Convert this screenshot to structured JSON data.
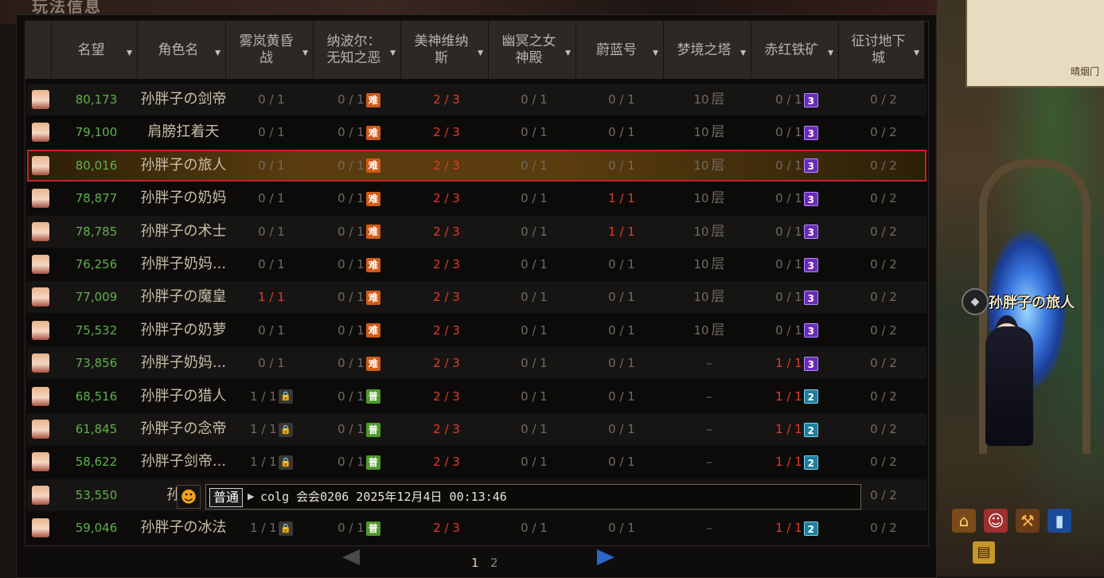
{
  "window": {
    "title": "玩法信息"
  },
  "header": {
    "columns": [
      {
        "label": "名望",
        "sort": true
      },
      {
        "label": "角色名",
        "sort": true
      },
      {
        "label": "雾岚黄昏战",
        "sort": true
      },
      {
        "label": "纳波尔：无知之恶",
        "sort": true
      },
      {
        "label": "美神维纳斯",
        "sort": true
      },
      {
        "label": "幽冥之女神殿",
        "sort": true
      },
      {
        "label": "蔚蓝号",
        "sort": true
      },
      {
        "label": "梦境之塔",
        "sort": true
      },
      {
        "label": "赤红铁矿",
        "sort": true
      },
      {
        "label": "征讨地下城",
        "sort": true
      }
    ]
  },
  "rows": [
    {
      "fame": "80,173",
      "name": "孙胖子の剑帝",
      "c1": "0 / 1",
      "c1red": false,
      "c1badge": "",
      "c2": "0 / 1",
      "c2badge": "难",
      "c3": "2 / 3",
      "c4": "0 / 1",
      "c5": "0 / 1",
      "c5red": false,
      "floor": "10",
      "floor_unit": "层",
      "c7": "0 / 1",
      "c7red": false,
      "c7badge": "3",
      "c8": "0 / 2"
    },
    {
      "fame": "79,100",
      "name": "肩膀扛着天",
      "c1": "0 / 1",
      "c1red": false,
      "c1badge": "",
      "c2": "0 / 1",
      "c2badge": "难",
      "c3": "2 / 3",
      "c4": "0 / 1",
      "c5": "0 / 1",
      "c5red": false,
      "floor": "10",
      "floor_unit": "层",
      "c7": "0 / 1",
      "c7red": false,
      "c7badge": "3",
      "c8": "0 / 2"
    },
    {
      "fame": "80,016",
      "name": "孙胖子の旅人",
      "c1": "0 / 1",
      "c1red": false,
      "c1badge": "",
      "c2": "0 / 1",
      "c2badge": "难",
      "c3": "2 / 3",
      "c4": "0 / 1",
      "c5": "0 / 1",
      "c5red": false,
      "floor": "10",
      "floor_unit": "层",
      "c7": "0 / 1",
      "c7red": false,
      "c7badge": "3",
      "c8": "0 / 2",
      "selected": true
    },
    {
      "fame": "78,877",
      "name": "孙胖子の奶妈",
      "c1": "0 / 1",
      "c1red": false,
      "c1badge": "",
      "c2": "0 / 1",
      "c2badge": "难",
      "c3": "2 / 3",
      "c4": "0 / 1",
      "c5": "1 / 1",
      "c5red": true,
      "floor": "10",
      "floor_unit": "层",
      "c7": "0 / 1",
      "c7red": false,
      "c7badge": "3",
      "c8": "0 / 2"
    },
    {
      "fame": "78,785",
      "name": "孙胖子の术士",
      "c1": "0 / 1",
      "c1red": false,
      "c1badge": "",
      "c2": "0 / 1",
      "c2badge": "难",
      "c3": "2 / 3",
      "c4": "0 / 1",
      "c5": "1 / 1",
      "c5red": true,
      "floor": "10",
      "floor_unit": "层",
      "c7": "0 / 1",
      "c7red": false,
      "c7badge": "3",
      "c8": "0 / 2"
    },
    {
      "fame": "76,256",
      "name": "孙胖子奶妈...",
      "c1": "0 / 1",
      "c1red": false,
      "c1badge": "",
      "c2": "0 / 1",
      "c2badge": "难",
      "c3": "2 / 3",
      "c4": "0 / 1",
      "c5": "0 / 1",
      "c5red": false,
      "floor": "10",
      "floor_unit": "层",
      "c7": "0 / 1",
      "c7red": false,
      "c7badge": "3",
      "c8": "0 / 2"
    },
    {
      "fame": "77,009",
      "name": "孙胖子の魔皇",
      "c1": "1 / 1",
      "c1red": true,
      "c1badge": "",
      "c2": "0 / 1",
      "c2badge": "难",
      "c3": "2 / 3",
      "c4": "0 / 1",
      "c5": "0 / 1",
      "c5red": false,
      "floor": "10",
      "floor_unit": "层",
      "c7": "0 / 1",
      "c7red": false,
      "c7badge": "3",
      "c8": "0 / 2"
    },
    {
      "fame": "75,532",
      "name": "孙胖子の奶萝",
      "c1": "0 / 1",
      "c1red": false,
      "c1badge": "",
      "c2": "0 / 1",
      "c2badge": "难",
      "c3": "2 / 3",
      "c4": "0 / 1",
      "c5": "0 / 1",
      "c5red": false,
      "floor": "10",
      "floor_unit": "层",
      "c7": "0 / 1",
      "c7red": false,
      "c7badge": "3",
      "c8": "0 / 2"
    },
    {
      "fame": "73,856",
      "name": "孙胖子奶妈...",
      "c1": "0 / 1",
      "c1red": false,
      "c1badge": "",
      "c2": "0 / 1",
      "c2badge": "难",
      "c3": "2 / 3",
      "c4": "0 / 1",
      "c5": "0 / 1",
      "c5red": false,
      "floor": "–",
      "floor_unit": "",
      "c7": "1 / 1",
      "c7red": true,
      "c7badge": "3",
      "c8": "0 / 2"
    },
    {
      "fame": "68,516",
      "name": "孙胖子の猎人",
      "c1": "1 / 1",
      "c1red": false,
      "c1badge": "lock",
      "c2": "0 / 1",
      "c2badge": "普",
      "c3": "2 / 3",
      "c4": "0 / 1",
      "c5": "0 / 1",
      "c5red": false,
      "floor": "–",
      "floor_unit": "",
      "c7": "1 / 1",
      "c7red": true,
      "c7badge": "2",
      "c8": "0 / 2"
    },
    {
      "fame": "61,845",
      "name": "孙胖子の念帝",
      "c1": "1 / 1",
      "c1red": false,
      "c1badge": "lock",
      "c2": "0 / 1",
      "c2badge": "普",
      "c3": "2 / 3",
      "c4": "0 / 1",
      "c5": "0 / 1",
      "c5red": false,
      "floor": "–",
      "floor_unit": "",
      "c7": "1 / 1",
      "c7red": true,
      "c7badge": "2",
      "c8": "0 / 2"
    },
    {
      "fame": "58,622",
      "name": "孙胖子剑帝...",
      "c1": "1 / 1",
      "c1red": false,
      "c1badge": "lock",
      "c2": "0 / 1",
      "c2badge": "普",
      "c3": "2 / 3",
      "c4": "0 / 1",
      "c5": "0 / 1",
      "c5red": false,
      "floor": "–",
      "floor_unit": "",
      "c7": "1 / 1",
      "c7red": true,
      "c7badge": "2",
      "c8": "0 / 2"
    },
    {
      "fame": "53,550",
      "name": "孙胖-",
      "c1": "",
      "c1red": false,
      "c1badge": "",
      "c2": "",
      "c2badge": "",
      "c3": "",
      "c4": "",
      "c5": "",
      "c5red": false,
      "floor": "",
      "floor_unit": "",
      "c7": "",
      "c7red": false,
      "c7badge": "",
      "c8": "0 / 2"
    },
    {
      "fame": "59,046",
      "name": "孙胖子の冰法",
      "c1": "1 / 1",
      "c1red": false,
      "c1badge": "lock",
      "c2": "0 / 1",
      "c2badge": "普",
      "c3": "2 / 3",
      "c4": "0 / 1",
      "c5": "0 / 1",
      "c5red": false,
      "floor": "–",
      "floor_unit": "",
      "c7": "1 / 1",
      "c7red": true,
      "c7badge": "2",
      "c8": "0 / 2"
    }
  ],
  "chat": {
    "channel": "普通",
    "message": "colg 会会0206 2025年12月4日 00:13:46"
  },
  "pagination": {
    "pages": [
      "1",
      "2"
    ],
    "current": "1"
  },
  "side": {
    "character_name": "孙胖子の旅人",
    "parchment_text": "晴烟门"
  }
}
